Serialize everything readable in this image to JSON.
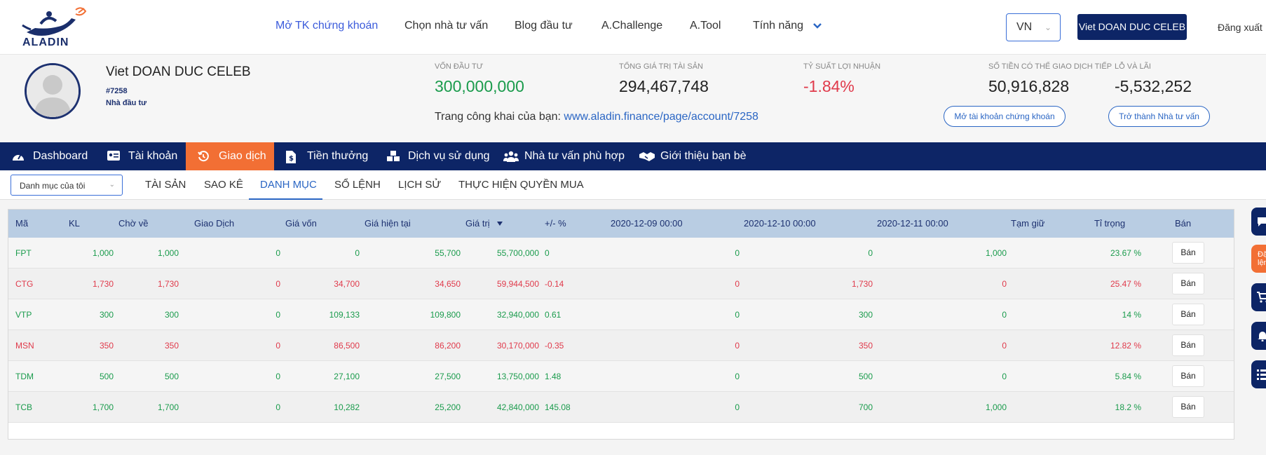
{
  "brand": {
    "logo_text": "ALADIN"
  },
  "nav": {
    "items": [
      "Mở TK chứng khoán",
      "Chọn nhà tư vấn",
      "Blog đầu tư",
      "A.Challenge",
      "A.Tool",
      "Tính năng"
    ],
    "lang": "VN",
    "user_button": "Viet DOAN DUC CELEB",
    "logout": "Đăng xuất"
  },
  "profile": {
    "name": "Viet DOAN DUC CELEB",
    "id": "#7258",
    "role": "Nhà đầu tư",
    "stats": [
      {
        "label": "Vốn đầu tư",
        "value": "300,000,000",
        "color": "green"
      },
      {
        "label": "Tổng giá trị tài sản",
        "value": "294,467,748",
        "color": "dark"
      },
      {
        "label": "Tỷ suất lợi nhuận",
        "value": "-1.84%",
        "color": "red"
      },
      {
        "label": "Số tiền có thể giao dịch tiếp",
        "value": "50,916,828",
        "color": "dark"
      },
      {
        "label": "Lỗ và lãi",
        "value": "-5,532,252",
        "color": "dark"
      }
    ],
    "public_label": "Trang công khai của bạn:",
    "public_url": "www.aladin.finance/page/account/7258",
    "open_account_button": "Mở tài khoản chứng khoán",
    "advisor_button": "Trở thành Nhà tư vấn"
  },
  "main_nav": [
    {
      "label": "Dashboard",
      "icon": "dashboard-icon"
    },
    {
      "label": "Tài khoản",
      "icon": "id-card-icon"
    },
    {
      "label": "Giao dịch",
      "icon": "history-icon",
      "active": true
    },
    {
      "label": "Tiền thưởng",
      "icon": "dollar-file-icon"
    },
    {
      "label": "Dịch vụ sử dụng",
      "icon": "cubes-icon"
    },
    {
      "label": "Nhà tư vấn phù hợp",
      "icon": "users-icon"
    },
    {
      "label": "Giới thiệu bạn bè",
      "icon": "handshake-icon"
    }
  ],
  "sub_nav": {
    "folder": "Danh mục của tôi",
    "tabs": [
      "TÀI SẢN",
      "SAO KÊ",
      "DANH MỤC",
      "SỔ LỆNH",
      "LỊCH SỬ",
      "THỰC HIỆN QUYỀN MUA"
    ],
    "active_tab": "DANH MỤC"
  },
  "table": {
    "headers": [
      "Mã",
      "KL",
      "Chờ về",
      "Giao Dịch",
      "Giá vốn",
      "Giá hiện tại",
      "Giá trị",
      "+/- %",
      "2020-12-09 00:00",
      "2020-12-10 00:00",
      "2020-12-11 00:00",
      "Tạm giữ",
      "Tỉ trọng",
      "Bán"
    ],
    "sort_column": "Giá trị",
    "sell_label": "Bán",
    "rows": [
      {
        "color": "green",
        "cells": [
          "FPT",
          "1,000",
          "1,000",
          "0",
          "0",
          "55,700",
          "55,700,000",
          "0",
          "0",
          "0",
          "1,000",
          "23.67 %"
        ]
      },
      {
        "color": "red",
        "cells": [
          "CTG",
          "1,730",
          "1,730",
          "0",
          "34,700",
          "34,650",
          "59,944,500",
          "-0.14",
          "0",
          "1,730",
          "0",
          "25.47 %"
        ]
      },
      {
        "color": "green",
        "cells": [
          "VTP",
          "300",
          "300",
          "0",
          "109,133",
          "109,800",
          "32,940,000",
          "0.61",
          "0",
          "300",
          "0",
          "14 %"
        ]
      },
      {
        "color": "red",
        "cells": [
          "MSN",
          "350",
          "350",
          "0",
          "86,500",
          "86,200",
          "30,170,000",
          "-0.35",
          "0",
          "350",
          "0",
          "12.82 %"
        ]
      },
      {
        "color": "green",
        "cells": [
          "TDM",
          "500",
          "500",
          "0",
          "27,100",
          "27,500",
          "13,750,000",
          "1.48",
          "0",
          "500",
          "0",
          "5.84 %"
        ]
      },
      {
        "color": "green",
        "cells": [
          "TCB",
          "1,700",
          "1,700",
          "0",
          "10,282",
          "25,200",
          "42,840,000",
          "145.08",
          "0",
          "700",
          "1,000",
          "18.2 %"
        ]
      }
    ]
  },
  "side_widgets": [
    "chat-icon",
    "Đặt lệnh",
    "cart-icon",
    "bell-icon",
    "list-icon"
  ],
  "colors": {
    "navy": "#0d2566",
    "orange": "#f26f34",
    "link": "#2b66c4",
    "green": "#1a9b4c",
    "red": "#e03a4b",
    "table_header": "#b9cde3"
  }
}
